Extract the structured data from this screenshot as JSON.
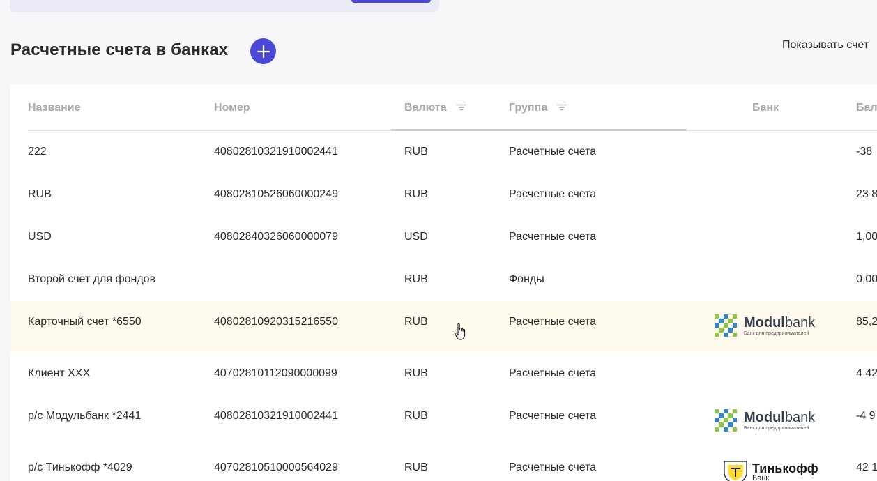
{
  "header": {
    "title": "Расчетные счета в банках",
    "show_label": "Показывать счет"
  },
  "table": {
    "columns": {
      "name": "Название",
      "number": "Номер",
      "currency": "Валюта",
      "group": "Группа",
      "bank": "Банк",
      "balance": "Бал"
    },
    "rows": [
      {
        "name": "222",
        "number": "40802810321910002441",
        "currency": "RUB",
        "group": "Расчетные счета",
        "bank": "",
        "balance": "-38"
      },
      {
        "name": "RUB",
        "number": "40802810526060000249",
        "currency": "RUB",
        "group": "Расчетные счета",
        "bank": "",
        "balance": "23 8"
      },
      {
        "name": "USD",
        "number": "40802840326060000079",
        "currency": "USD",
        "group": "Расчетные счета",
        "bank": "",
        "balance": "1,00"
      },
      {
        "name": "Второй счет для фондов",
        "number": "",
        "currency": "RUB",
        "group": "Фонды",
        "bank": "",
        "balance": "0,00"
      },
      {
        "name": "Карточный счет *6550",
        "number": "40802810920315216550",
        "currency": "RUB",
        "group": "Расчетные счета",
        "bank": "modulbank",
        "balance": "85,2"
      },
      {
        "name": "Клиент ХХХ",
        "number": "40702810112090000099",
        "currency": "RUB",
        "group": "Расчетные счета",
        "bank": "",
        "balance": "4 42"
      },
      {
        "name": "р/с Модульбанк *2441",
        "number": "40802810321910002441",
        "currency": "RUB",
        "group": "Расчетные счета",
        "bank": "modulbank",
        "balance": "-4 9"
      },
      {
        "name": "р/с Тинькофф *4029",
        "number": "40702810510000564029",
        "currency": "RUB",
        "group": "Расчетные счета",
        "bank": "tinkoff",
        "balance": "42 1"
      }
    ]
  },
  "logos": {
    "modulbank": {
      "name_bold": "Modul",
      "name_light": "bank",
      "subtitle": "Банк для предпринимателей"
    },
    "tinkoff": {
      "name": "Тинькофф",
      "subtitle": "Банк"
    }
  },
  "colors": {
    "accent": "#4a47d9",
    "highlight_row": "#fff9ee",
    "header_text": "#a9a9ae",
    "modul_green": "#8cc63e",
    "modul_blue": "#2f86c9"
  }
}
